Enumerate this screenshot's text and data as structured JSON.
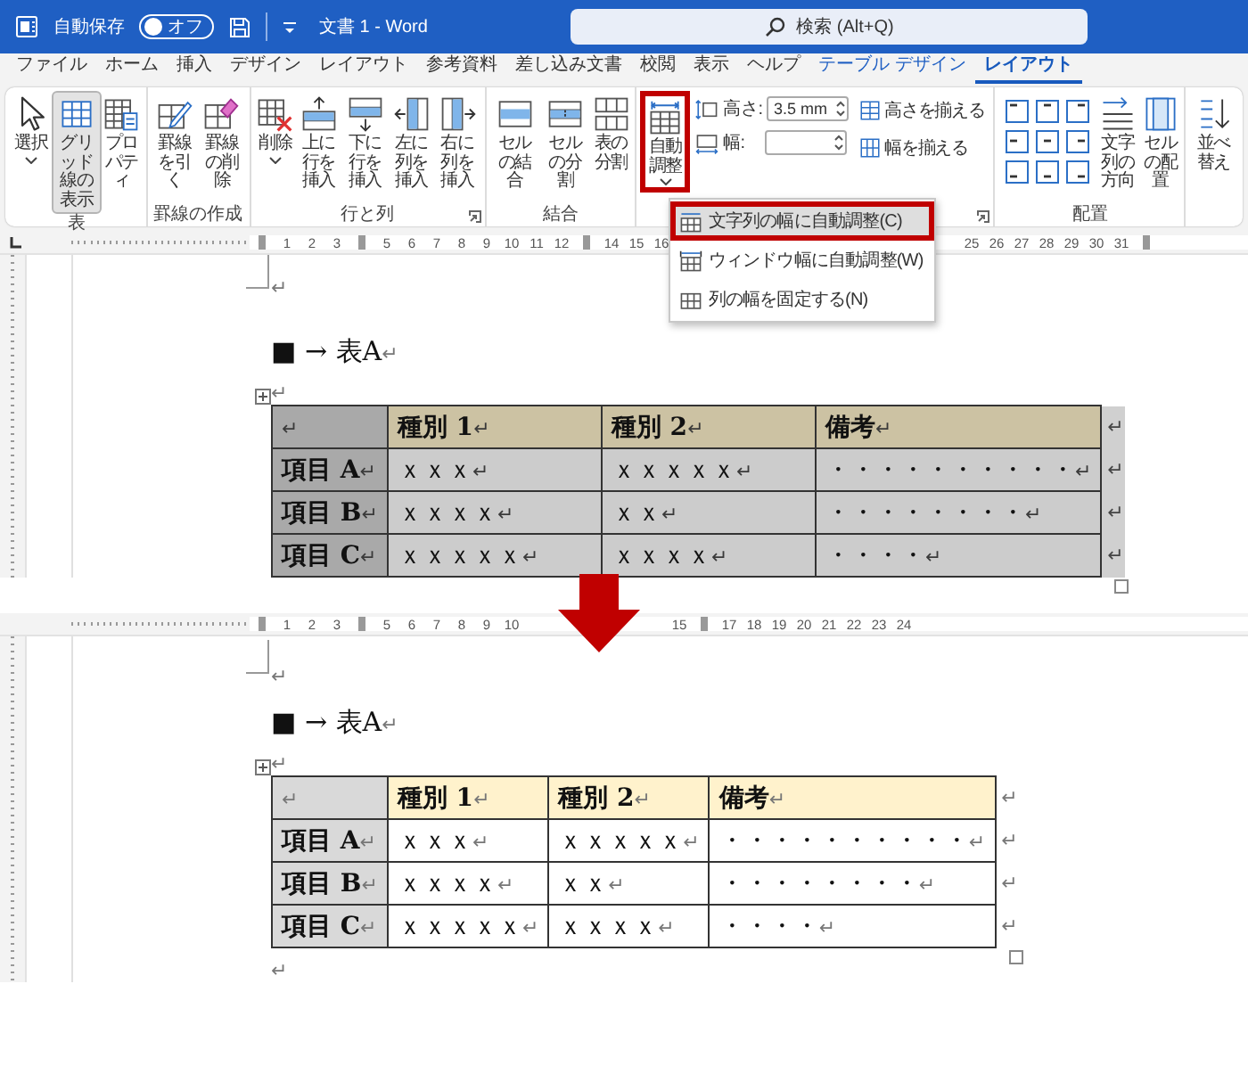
{
  "title_bar": {
    "autosave_label": "自動保存",
    "autosave_toggle": {
      "label": "オフ",
      "on": false
    },
    "document_title": "文書 1 - Word",
    "search": {
      "placeholder": "検索 (Alt+Q)"
    }
  },
  "menu_tabs": [
    {
      "label": "ファイル",
      "selected": false,
      "contextual": false
    },
    {
      "label": "ホーム",
      "selected": false,
      "contextual": false
    },
    {
      "label": "挿入",
      "selected": false,
      "contextual": false
    },
    {
      "label": "デザイン",
      "selected": false,
      "contextual": false
    },
    {
      "label": "レイアウト",
      "selected": false,
      "contextual": false
    },
    {
      "label": "参考資料",
      "selected": false,
      "contextual": false
    },
    {
      "label": "差し込み文書",
      "selected": false,
      "contextual": false
    },
    {
      "label": "校閲",
      "selected": false,
      "contextual": false
    },
    {
      "label": "表示",
      "selected": false,
      "contextual": false
    },
    {
      "label": "ヘルプ",
      "selected": false,
      "contextual": false
    },
    {
      "label": "テーブル デザイン",
      "selected": false,
      "contextual": true
    },
    {
      "label": "レイアウト",
      "selected": true,
      "contextual": true
    }
  ],
  "ribbon_groups": [
    {
      "label": "表",
      "launcher": false,
      "items": [
        {
          "kind": "large",
          "label": "選択",
          "dropdown": true,
          "pressed": false,
          "highlighted": false
        },
        {
          "kind": "large",
          "label": "グリッド線の表示",
          "dropdown": false,
          "pressed": true,
          "highlighted": false
        },
        {
          "kind": "large",
          "label": "プロパティ",
          "dropdown": false,
          "pressed": false,
          "highlighted": false
        }
      ]
    },
    {
      "label": "罫線の作成",
      "launcher": false,
      "items": [
        {
          "kind": "large",
          "label": "罫線を引く",
          "dropdown": false,
          "pressed": false,
          "highlighted": false
        },
        {
          "kind": "large",
          "label": "罫線の削除",
          "dropdown": false,
          "pressed": false,
          "highlighted": false
        }
      ]
    },
    {
      "label": "行と列",
      "launcher": true,
      "items": [
        {
          "kind": "large",
          "label": "削除",
          "dropdown": true,
          "pressed": false,
          "highlighted": false
        },
        {
          "kind": "large",
          "label": "上に行を挿入",
          "dropdown": false,
          "pressed": false,
          "highlighted": false
        },
        {
          "kind": "large",
          "label": "下に行を挿入",
          "dropdown": false,
          "pressed": false,
          "highlighted": false
        },
        {
          "kind": "large",
          "label": "左に列を挿入",
          "dropdown": false,
          "pressed": false,
          "highlighted": false
        },
        {
          "kind": "large",
          "label": "右に列を挿入",
          "dropdown": false,
          "pressed": false,
          "highlighted": false
        }
      ]
    },
    {
      "label": "結合",
      "launcher": false,
      "items": [
        {
          "kind": "large",
          "label": "セルの結合",
          "dropdown": false,
          "pressed": false,
          "highlighted": false
        },
        {
          "kind": "large",
          "label": "セルの分割",
          "dropdown": false,
          "pressed": false,
          "highlighted": false
        },
        {
          "kind": "large",
          "label": "表の分割",
          "dropdown": false,
          "pressed": false,
          "highlighted": false
        }
      ]
    },
    {
      "launcher": true,
      "items": [
        {
          "kind": "large",
          "label": "自動調整",
          "dropdown": true,
          "pressed": false,
          "highlighted": true,
          "menu": [
            {
              "label": "文字列の幅に自動調整(C)",
              "selected": true,
              "highlighted": true
            },
            {
              "label": "ウィンドウ幅に自動調整(W)",
              "selected": false,
              "highlighted": false
            },
            {
              "label": "列の幅を固定する(N)",
              "selected": false,
              "highlighted": false
            }
          ]
        },
        {
          "kind": "fields",
          "fields": [
            {
              "label": "高さ:",
              "value": "3.5 mm"
            },
            {
              "label": "幅:"
            }
          ]
        },
        {
          "kind": "small_buttons",
          "buttons": [
            {
              "label": "高さを揃える"
            },
            {
              "label": "幅を揃える"
            }
          ]
        }
      ]
    },
    {
      "label": "配置",
      "launcher": false,
      "items": [
        {
          "kind": "align_grid"
        },
        {
          "kind": "large",
          "label": "文字列の方向",
          "dropdown": false,
          "pressed": false,
          "highlighted": false
        },
        {
          "kind": "large",
          "label": "セルの配置",
          "dropdown": false,
          "pressed": false,
          "highlighted": false
        }
      ]
    },
    {
      "items": [
        {
          "kind": "large",
          "label": "並べ替え",
          "dropdown": false,
          "pressed": false,
          "highlighted": false
        }
      ]
    }
  ],
  "document_views": [
    {
      "ruler": [
        {
          "kind": "marker"
        },
        {
          "kind": "number",
          "label": "1"
        },
        {
          "kind": "number",
          "label": "2"
        },
        {
          "kind": "number",
          "label": "3"
        },
        {
          "kind": "marker"
        },
        {
          "kind": "number",
          "label": "5"
        },
        {
          "kind": "number",
          "label": "6"
        },
        {
          "kind": "number",
          "label": "7"
        },
        {
          "kind": "number",
          "label": "8"
        },
        {
          "kind": "number",
          "label": "9"
        },
        {
          "kind": "number",
          "label": "10"
        },
        {
          "kind": "number",
          "label": "11"
        },
        {
          "kind": "number",
          "label": "12"
        },
        {
          "kind": "marker"
        },
        {
          "kind": "number",
          "label": "14"
        },
        {
          "kind": "number",
          "label": "15"
        },
        {
          "kind": "number",
          "label": "16"
        },
        {
          "kind": "gap"
        },
        {
          "kind": "gap"
        },
        {
          "kind": "gap"
        },
        {
          "kind": "gap"
        },
        {
          "kind": "gap"
        },
        {
          "kind": "gap"
        },
        {
          "kind": "gap"
        },
        {
          "kind": "gap"
        },
        {
          "kind": "number",
          "label": "25"
        },
        {
          "kind": "number",
          "label": "26"
        },
        {
          "kind": "number",
          "label": "27"
        },
        {
          "kind": "number",
          "label": "28"
        },
        {
          "kind": "number",
          "label": "29"
        },
        {
          "kind": "number",
          "label": "30"
        },
        {
          "kind": "number",
          "label": "31"
        },
        {
          "kind": "marker"
        }
      ],
      "blocks": [
        {
          "kind": "paragraph",
          "mark": "↵"
        },
        {
          "kind": "paragraph",
          "text": "■ → 表A",
          "mark": "↵"
        },
        {
          "kind": "paragraph",
          "mark": "↵"
        },
        {
          "kind": "table",
          "selected": true,
          "autofit": false,
          "rows": [
            {
              "cells": [
                {
                  "mark": "↵"
                },
                {
                  "text": "種別 1",
                  "mark": "↵"
                },
                {
                  "text": "種別 2",
                  "mark": "↵"
                },
                {
                  "text": "備考",
                  "mark": "↵"
                }
              ],
              "end_mark": "↵"
            },
            {
              "cells": [
                {
                  "text": "項目 A",
                  "mark": "↵"
                },
                {
                  "text": "ｘｘｘ",
                  "mark": "↵"
                },
                {
                  "text": "ｘｘｘｘｘ",
                  "mark": "↵"
                },
                {
                  "text": "・・・・・・・・・・",
                  "mark": "↵"
                }
              ],
              "end_mark": "↵"
            },
            {
              "cells": [
                {
                  "text": "項目 B",
                  "mark": "↵"
                },
                {
                  "text": "ｘｘｘｘ",
                  "mark": "↵"
                },
                {
                  "text": "ｘｘ",
                  "mark": "↵"
                },
                {
                  "text": "・・・・・・・・",
                  "mark": "↵"
                }
              ],
              "end_mark": "↵"
            },
            {
              "cells": [
                {
                  "text": "項目 C",
                  "mark": "↵"
                },
                {
                  "text": "ｘｘｘｘｘ",
                  "mark": "↵"
                },
                {
                  "text": "ｘｘｘｘ",
                  "mark": "↵"
                },
                {
                  "text": "・・・・",
                  "mark": "↵"
                }
              ],
              "end_mark": "↵"
            }
          ]
        }
      ]
    },
    {
      "ruler": [
        {
          "kind": "marker"
        },
        {
          "kind": "number",
          "label": "1"
        },
        {
          "kind": "number",
          "label": "2"
        },
        {
          "kind": "number",
          "label": "3"
        },
        {
          "kind": "marker"
        },
        {
          "kind": "number",
          "label": "5"
        },
        {
          "kind": "number",
          "label": "6"
        },
        {
          "kind": "number",
          "label": "7"
        },
        {
          "kind": "number",
          "label": "8"
        },
        {
          "kind": "number",
          "label": "9"
        },
        {
          "kind": "number",
          "label": "10"
        },
        {
          "kind": "gap"
        },
        {
          "kind": "gap"
        },
        {
          "kind": "gap"
        },
        {
          "kind": "gap"
        },
        {
          "kind": "number",
          "label": "15"
        },
        {
          "kind": "marker"
        },
        {
          "kind": "number",
          "label": "17"
        },
        {
          "kind": "number",
          "label": "18"
        },
        {
          "kind": "number",
          "label": "19"
        },
        {
          "kind": "number",
          "label": "20"
        },
        {
          "kind": "number",
          "label": "21"
        },
        {
          "kind": "number",
          "label": "22"
        },
        {
          "kind": "number",
          "label": "23"
        },
        {
          "kind": "number",
          "label": "24"
        }
      ],
      "blocks": [
        {
          "kind": "paragraph",
          "mark": "↵"
        },
        {
          "kind": "paragraph",
          "text": "■ → 表A",
          "mark": "↵"
        },
        {
          "kind": "paragraph",
          "mark": "↵"
        },
        {
          "kind": "table",
          "selected": false,
          "autofit": true,
          "rows": [
            {
              "cells": [
                {
                  "mark": "↵"
                },
                {
                  "text": "種別 1",
                  "mark": "↵"
                },
                {
                  "text": "種別 2",
                  "mark": "↵"
                },
                {
                  "text": "備考",
                  "mark": "↵"
                }
              ],
              "end_mark": "↵"
            },
            {
              "cells": [
                {
                  "text": "項目 A",
                  "mark": "↵"
                },
                {
                  "text": "ｘｘｘ",
                  "mark": "↵"
                },
                {
                  "text": "ｘｘｘｘｘ",
                  "mark": "↵"
                },
                {
                  "text": "・・・・・・・・・・",
                  "mark": "↵"
                }
              ],
              "end_mark": "↵"
            },
            {
              "cells": [
                {
                  "text": "項目 B",
                  "mark": "↵"
                },
                {
                  "text": "ｘｘｘｘ",
                  "mark": "↵"
                },
                {
                  "text": "ｘｘ",
                  "mark": "↵"
                },
                {
                  "text": "・・・・・・・・",
                  "mark": "↵"
                }
              ],
              "end_mark": "↵"
            },
            {
              "cells": [
                {
                  "text": "項目 C",
                  "mark": "↵"
                },
                {
                  "text": "ｘｘｘｘｘ",
                  "mark": "↵"
                },
                {
                  "text": "ｘｘｘｘ",
                  "mark": "↵"
                },
                {
                  "text": "・・・・",
                  "mark": "↵"
                }
              ],
              "end_mark": "↵"
            }
          ]
        },
        {
          "kind": "paragraph",
          "mark": "↵"
        }
      ]
    }
  ]
}
